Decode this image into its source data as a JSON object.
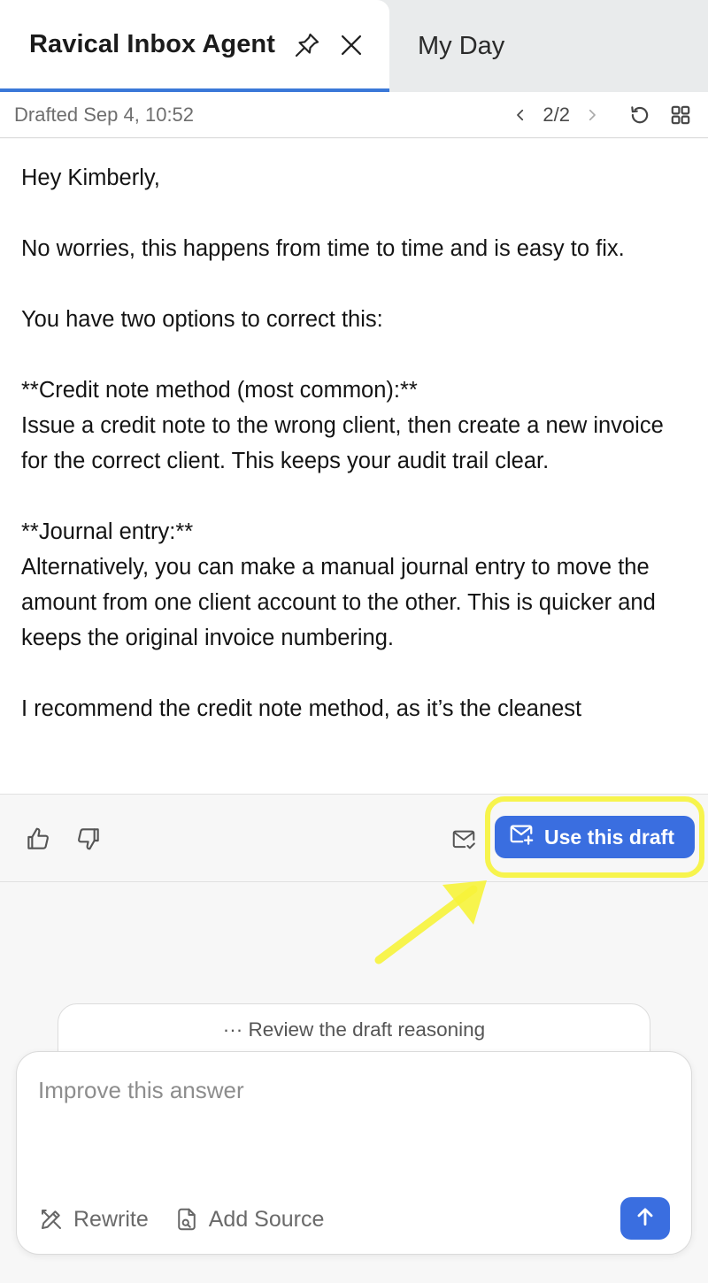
{
  "tabs": {
    "active_title": "Ravical Inbox Agent",
    "inactive_title": "My Day"
  },
  "toolbar": {
    "drafted": "Drafted Sep 4, 10:52",
    "pager": "2/2"
  },
  "draft": {
    "paragraphs": [
      "Hey Kimberly,",
      "No worries, this happens from time to time and is easy to fix.",
      "You have two options to correct this:",
      "**Credit note method (most common):**",
      "Issue a credit note to the wrong client, then create a new invoice for the correct client. This keeps your audit trail clear.",
      "**Journal entry:**",
      "Alternatively, you can make a manual journal entry to move the amount from one client account to the other. This is quicker and keeps the original invoice numbering.",
      "I recommend the credit note method, as it’s the cleanest"
    ]
  },
  "actions": {
    "use_draft_label": "Use this draft"
  },
  "reasoning": {
    "label": "··· Review the draft reasoning"
  },
  "composer": {
    "placeholder": "Improve this answer",
    "rewrite_label": "Rewrite",
    "add_source_label": "Add Source"
  },
  "colors": {
    "accent": "#3a6ee0",
    "tab_underline": "#3a78d8",
    "annotation": "#f6f33a"
  },
  "icons": [
    "pin-icon",
    "close-icon",
    "chevron-left-icon",
    "chevron-right-icon",
    "refresh-icon",
    "grid-icon",
    "thumbs-up-icon",
    "thumbs-down-icon",
    "mail-check-icon",
    "mail-plus-icon",
    "rewrite-icon",
    "add-source-icon",
    "arrow-up-icon"
  ]
}
